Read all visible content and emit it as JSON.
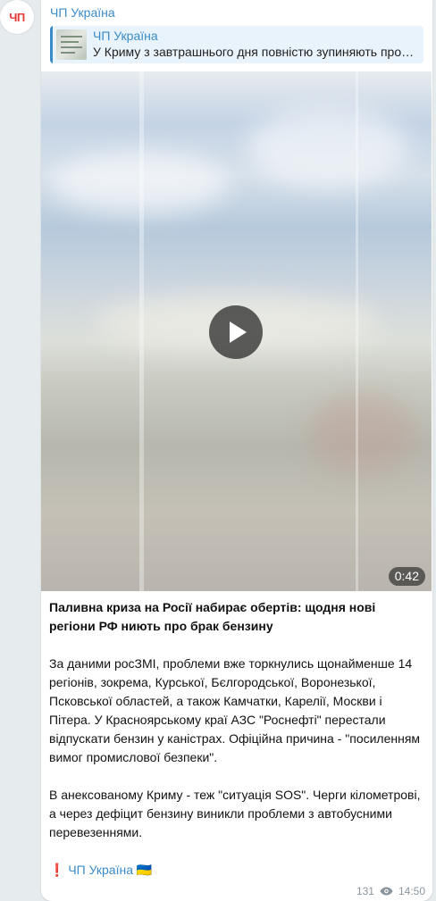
{
  "channel": {
    "avatar_text": "ЧП",
    "name": "ЧП Україна"
  },
  "reply": {
    "name": "ЧП Україна",
    "text": "У Криму з завтрашнього дня повністю зупиняють про…"
  },
  "video": {
    "duration": "0:42"
  },
  "caption": {
    "title": "Паливна криза на Росії набирає обертів: щодня нові регіони РФ ниють про брак бензину",
    "paragraph1": "За даними росЗМІ, проблеми вже торкнулись щонайменше 14 регіонів, зокрема, Курської, Бєлгородської, Воронезької, Псковської областей, а також Камчатки, Карелії, Москви і Пітера. У Красноярському краї АЗС \"Роснефті\" перестали відпускати бензин у каністрах. Офіційна причина - \"посиленням вимог промислової безпеки\".",
    "paragraph2": "В анексованому Криму - теж \"ситуація SOS\". Черги кілометрові, а через дефіцит бензину виникли проблеми з автобусними перевезеннями.",
    "signature_prefix": "❗",
    "signature_link": "ЧП Україна",
    "signature_flag": "🇺🇦"
  },
  "meta": {
    "views": "131",
    "time": "14:50"
  },
  "colors": {
    "accent": "#3a8bc8",
    "avatar_text": "#e53935"
  }
}
